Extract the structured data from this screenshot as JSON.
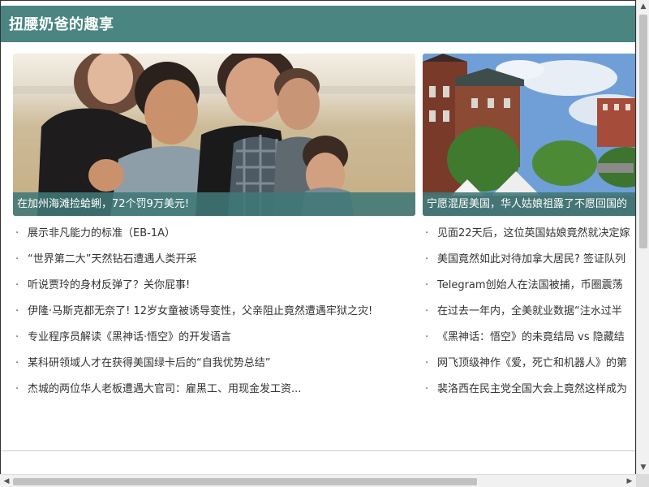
{
  "site": {
    "title": "扭腰奶爸的趣享"
  },
  "featured": [
    {
      "caption": "在加州海滩捡蛤蜊，72个罚9万美元!",
      "image": "family-on-beach-photo"
    },
    {
      "caption": "宁愿混居美国，华人姑娘祖露了不愿回国的",
      "image": "town-street-photo"
    }
  ],
  "left_list": [
    "展示非凡能力的标准（EB-1A）",
    "“世界第二大”天然钻石遭遇人类开采",
    "听说贾玲的身材反弹了？关你屁事!",
    "伊隆·马斯克都无奈了! 12岁女童被诱导变性，父亲阻止竟然遭遇牢狱之灾!",
    "专业程序员解读《黑神话·悟空》的开发语言",
    "某科研领域人才在获得美国绿卡后的“自我优势总结”",
    "杰城的两位华人老板遭遇大官司：雇黑工、用现金发工资..."
  ],
  "right_list": [
    "见面22天后，这位英国姑娘竟然就决定嫁",
    "美国竟然如此对待加拿大居民? 签证队列",
    "Telegram创始人在法国被捕，币圈震荡",
    "在过去一年内，全美就业数据“注水过半",
    "《黑神话：悟空》的未竟结局 vs 隐藏结",
    "网飞顶级神作《爱，死亡和机器人》的第",
    "裴洛西在民主党全国大会上竟然这样成为"
  ],
  "bullet": "·",
  "colors": {
    "header": "#4a8582",
    "caption_bg": "#407876"
  }
}
